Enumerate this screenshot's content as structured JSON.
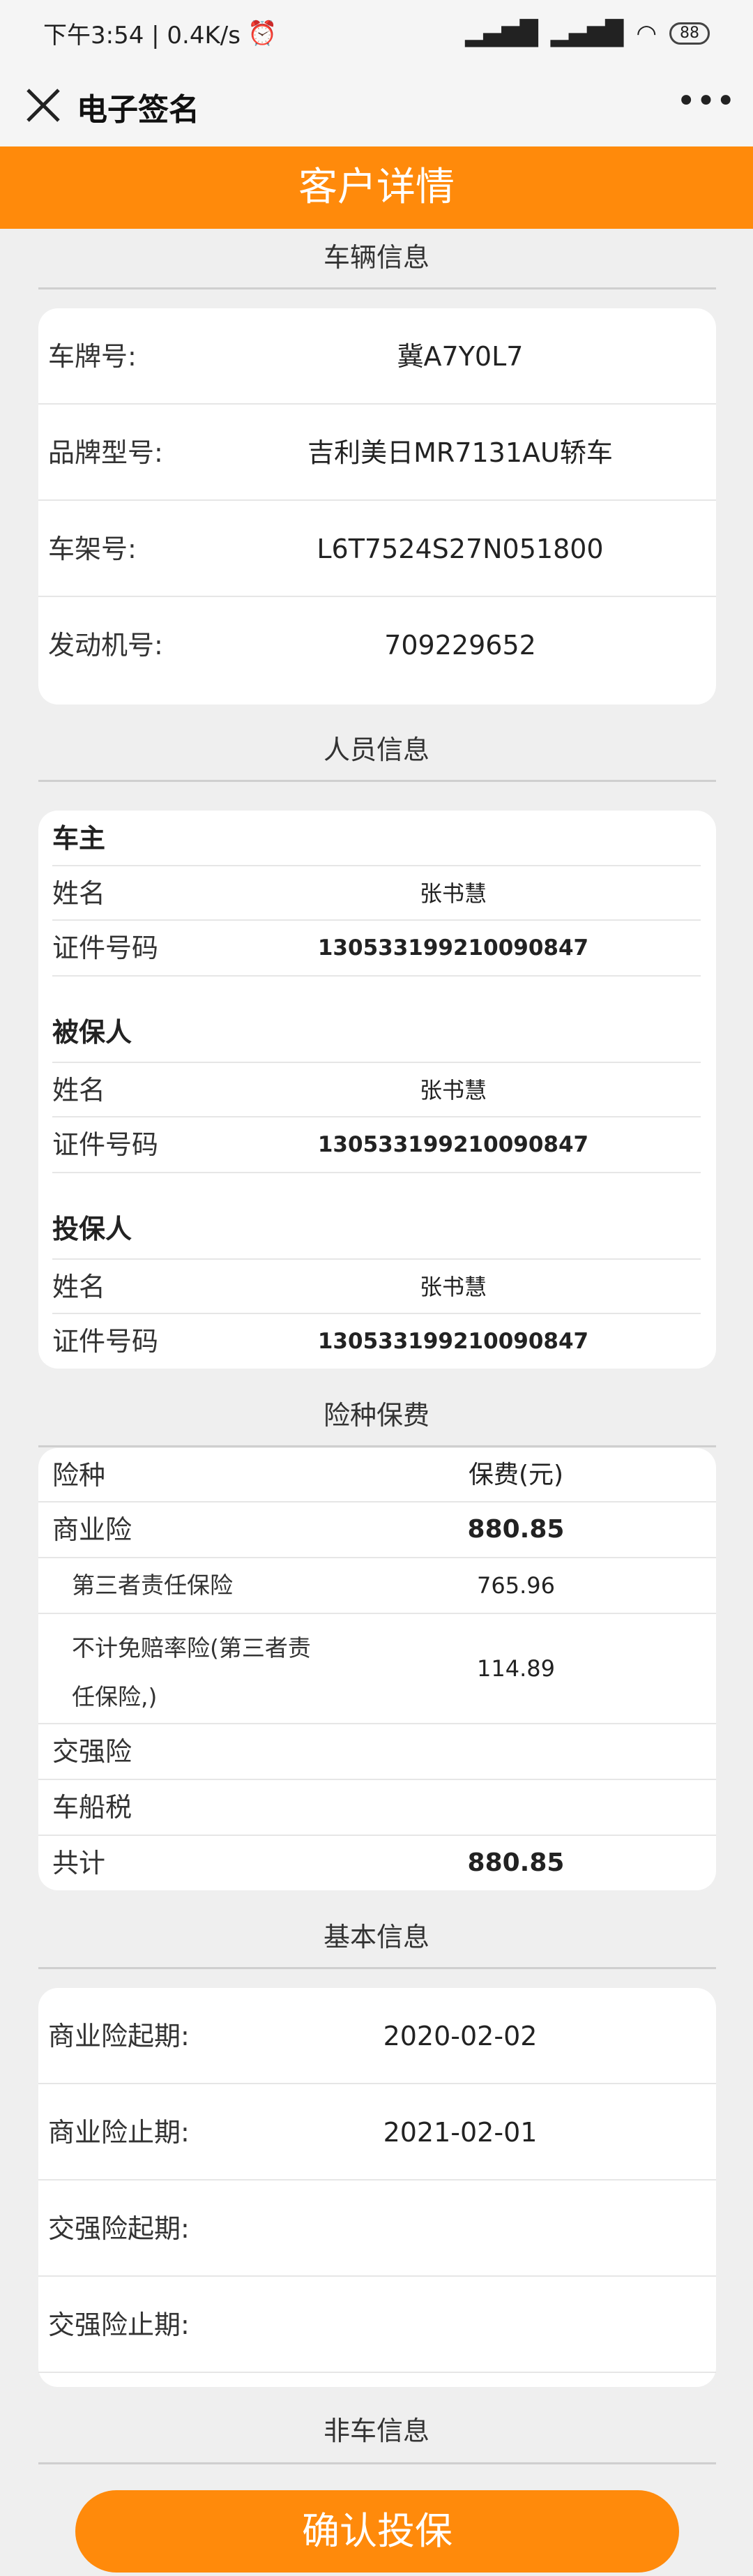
{
  "status_bar": {
    "time_speed": "下午3:54 | 0.4K/s",
    "battery": "88"
  },
  "nav": {
    "title": "电子签名"
  },
  "header": {
    "title": "客户详情"
  },
  "vehicle": {
    "section_title": "车辆信息",
    "rows": [
      {
        "label": "车牌号:",
        "value": "冀A7Y0L7"
      },
      {
        "label": "品牌型号:",
        "value": "吉利美日MR7131AU轿车"
      },
      {
        "label": "车架号:",
        "value": "L6T7524S27N051800"
      },
      {
        "label": "发动机号:",
        "value": "709229652"
      }
    ]
  },
  "persons": {
    "section_title": "人员信息",
    "groups": [
      {
        "heading": "车主",
        "name_label": "姓名",
        "name": "张书慧",
        "id_label": "证件号码",
        "id": "130533199210090847"
      },
      {
        "heading": "被保人",
        "name_label": "姓名",
        "name": "张书慧",
        "id_label": "证件号码",
        "id": "130533199210090847"
      },
      {
        "heading": "投保人",
        "name_label": "姓名",
        "name": "张书慧",
        "id_label": "证件号码",
        "id": "130533199210090847"
      }
    ]
  },
  "insurance": {
    "section_title": "险种保费",
    "header": {
      "label": "险种",
      "value": "保费(元)"
    },
    "commercial": {
      "label": "商业险",
      "value": "880.85"
    },
    "third_party": {
      "label": "第三者责任保险",
      "value": "765.96"
    },
    "deductible": {
      "label_line1": "不计免赔率险(第三者责",
      "label_line2": "任保险,)",
      "value": "114.89"
    },
    "compulsory": {
      "label": "交强险",
      "value": ""
    },
    "vessel_tax": {
      "label": "车船税",
      "value": ""
    },
    "total": {
      "label": "共计",
      "value": "880.85"
    }
  },
  "basic": {
    "section_title": "基本信息",
    "rows": [
      {
        "label": "商业险起期:",
        "value": "2020-02-02"
      },
      {
        "label": "商业险止期:",
        "value": "2021-02-01"
      },
      {
        "label": "交强险起期:",
        "value": ""
      },
      {
        "label": "交强险止期:",
        "value": ""
      }
    ]
  },
  "non_vehicle": {
    "section_title": "非车信息"
  },
  "confirm_button": {
    "label": "确认投保"
  }
}
